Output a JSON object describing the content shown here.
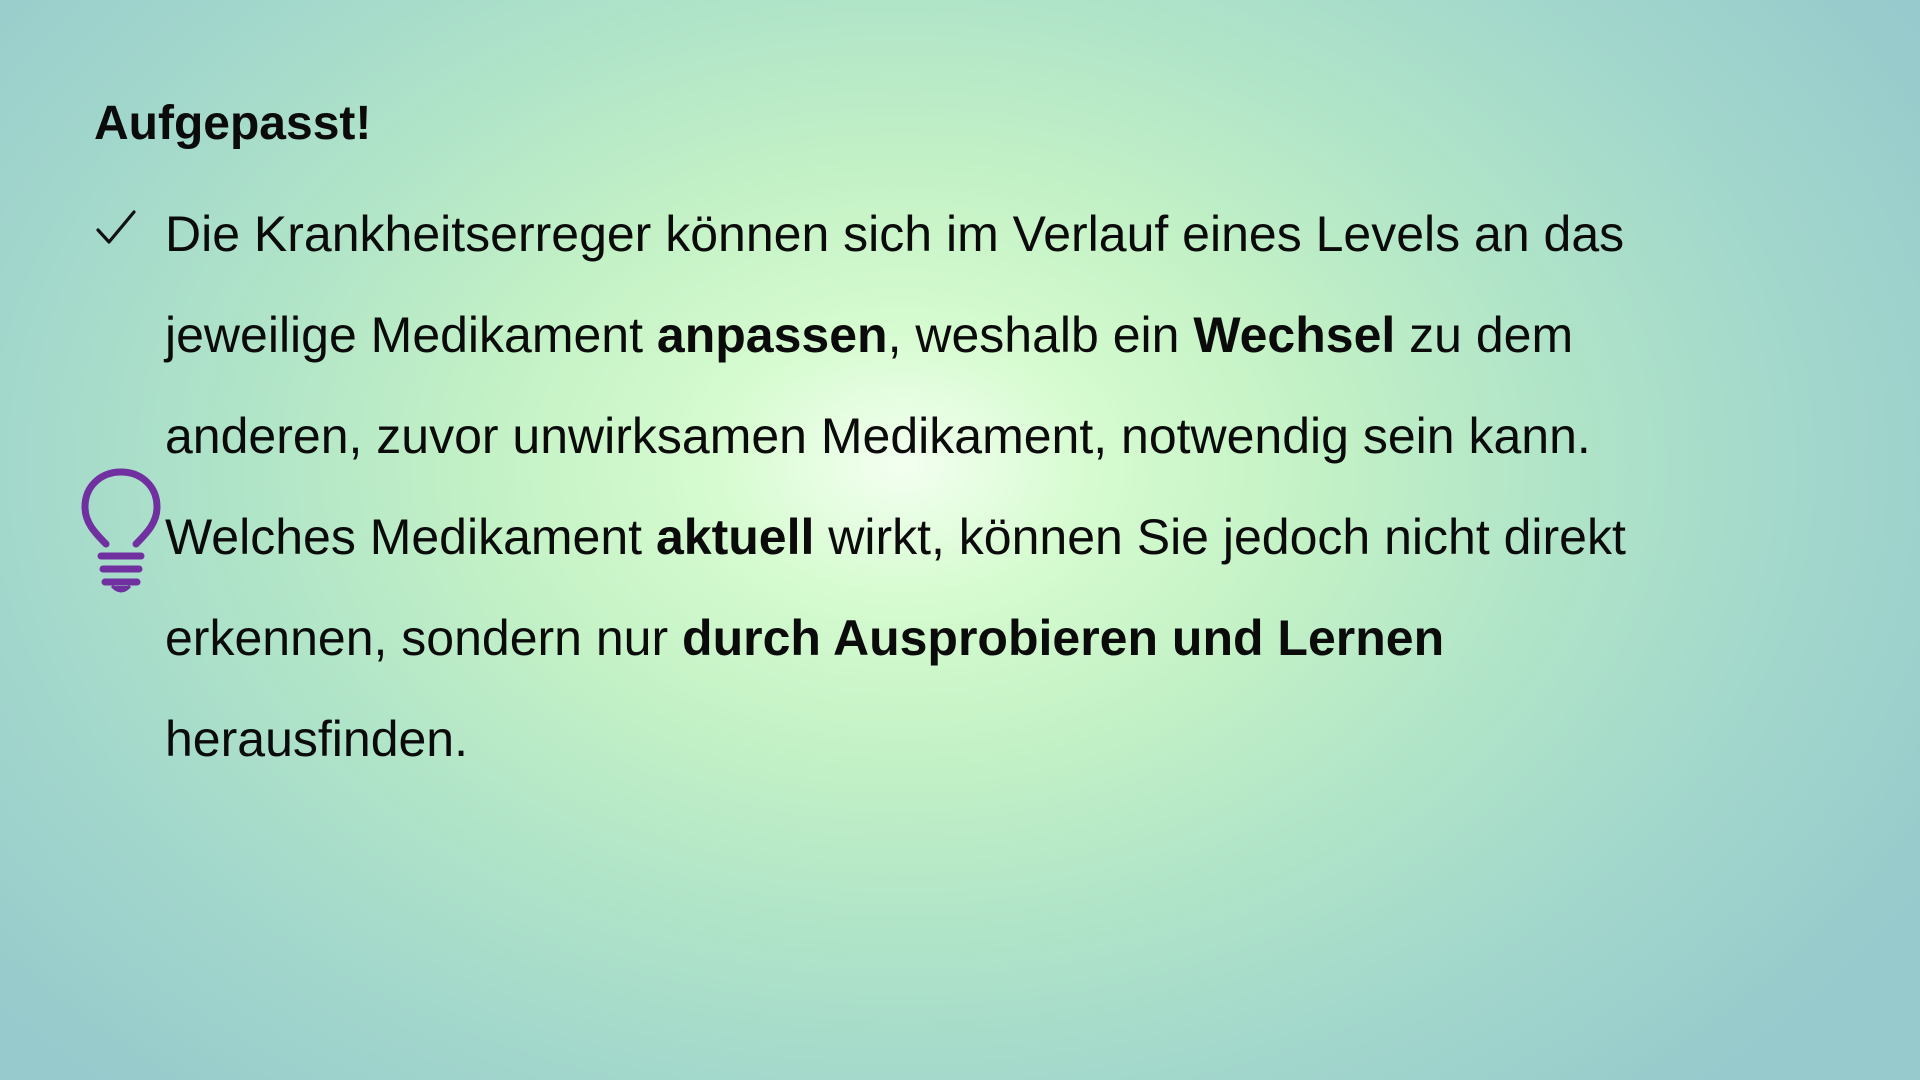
{
  "slide": {
    "title": "Aufgepasst!",
    "check_icon": "checkmark-icon",
    "hint_icon": "lightbulb-icon",
    "accent_color": "#7030a0",
    "lines": [
      [
        {
          "t": "Die Krankheitserreger können sich im Verlauf eines Levels an das",
          "b": false
        }
      ],
      [
        {
          "t": "jeweilige Medikament ",
          "b": false
        },
        {
          "t": "anpassen",
          "b": true
        },
        {
          "t": ", weshalb ein ",
          "b": false
        },
        {
          "t": "Wechsel",
          "b": true
        },
        {
          "t": " zu dem",
          "b": false
        }
      ],
      [
        {
          "t": "anderen, zuvor unwirksamen Medikament, notwendig sein kann.",
          "b": false
        }
      ],
      [
        {
          "t": "Welches Medikament ",
          "b": false
        },
        {
          "t": "aktuell",
          "b": true
        },
        {
          "t": " wirkt, können Sie jedoch nicht direkt",
          "b": false
        }
      ],
      [
        {
          "t": "erkennen, sondern nur ",
          "b": false
        },
        {
          "t": "durch Ausprobieren und Lernen",
          "b": true
        }
      ],
      [
        {
          "t": "herausfinden.",
          "b": false
        }
      ]
    ]
  }
}
